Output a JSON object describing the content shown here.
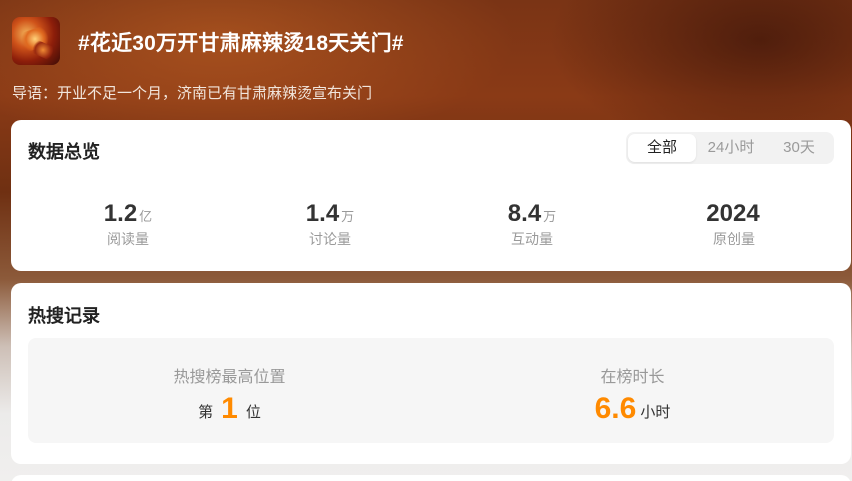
{
  "header": {
    "title": "#花近30万开甘肃麻辣烫18天关门#",
    "lead": "导语：开业不足一个月，济南已有甘肃麻辣烫宣布关门",
    "thumbnail_icon": "food-thumbnail"
  },
  "overview": {
    "title": "数据总览",
    "tabs": [
      {
        "label": "全部",
        "active": true
      },
      {
        "label": "24小时",
        "active": false
      },
      {
        "label": "30天",
        "active": false
      }
    ],
    "stats": [
      {
        "value": "1.2",
        "unit": "亿",
        "label": "阅读量"
      },
      {
        "value": "1.4",
        "unit": "万",
        "label": "讨论量"
      },
      {
        "value": "8.4",
        "unit": "万",
        "label": "互动量"
      },
      {
        "value": "2024",
        "unit": "",
        "label": "原创量"
      }
    ]
  },
  "hot_search": {
    "title": "热搜记录",
    "peak": {
      "label": "热搜榜最高位置",
      "prefix": "第",
      "value": "1",
      "suffix": "位"
    },
    "duration": {
      "label": "在榜时长",
      "value": "6.6",
      "suffix": "小时"
    }
  },
  "colors": {
    "accent": "#ff8a00",
    "card": "#ffffff"
  }
}
